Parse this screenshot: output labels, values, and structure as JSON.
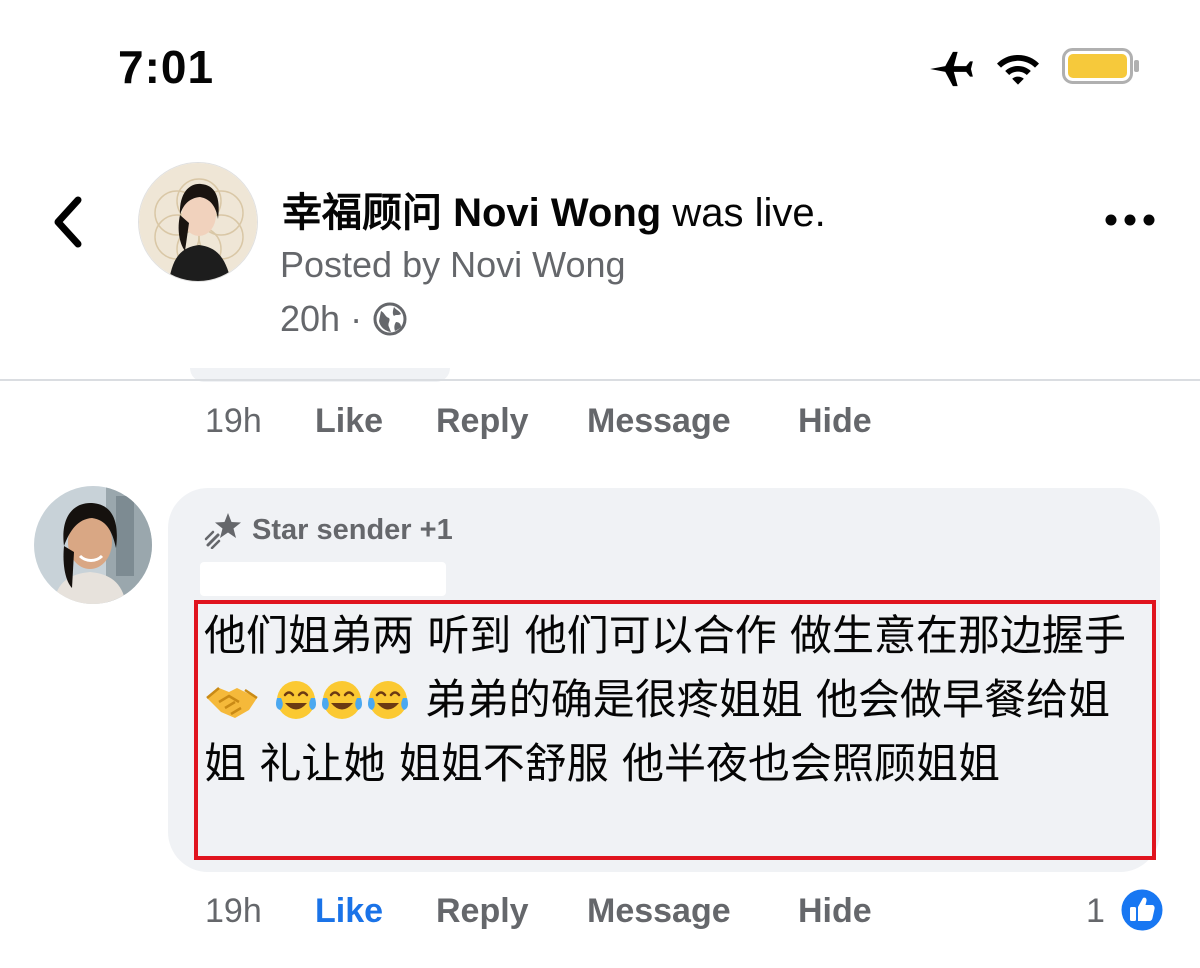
{
  "status_bar": {
    "time": "7:01"
  },
  "header": {
    "title_name": "幸福顾问 Novi Wong",
    "title_suffix": " was live.",
    "posted_by": "Posted by Novi Wong",
    "time": "20h",
    "separator": "·"
  },
  "previous_comment_actions": {
    "time": "19h",
    "like": "Like",
    "reply": "Reply",
    "message": "Message",
    "hide": "Hide"
  },
  "comment": {
    "badge": "Star sender +1",
    "text_part1": "他们姐弟两 听到 他们可以合作 做生意在那边握手",
    "text_part2": " 弟弟的确是很疼姐姐 他会做早餐给姐姐 礼让她 姐姐不舒服 他半夜也会照顾姐姐",
    "emojis": [
      "handshake",
      "tears-of-joy",
      "tears-of-joy",
      "tears-of-joy"
    ],
    "actions": {
      "time": "19h",
      "like": "Like",
      "reply": "Reply",
      "message": "Message",
      "hide": "Hide"
    },
    "reaction_count": "1"
  },
  "colors": {
    "accent": "#1877f2",
    "highlight_border": "#e0141e",
    "bubble": "#f0f2f5",
    "secondary_text": "#65676b"
  }
}
